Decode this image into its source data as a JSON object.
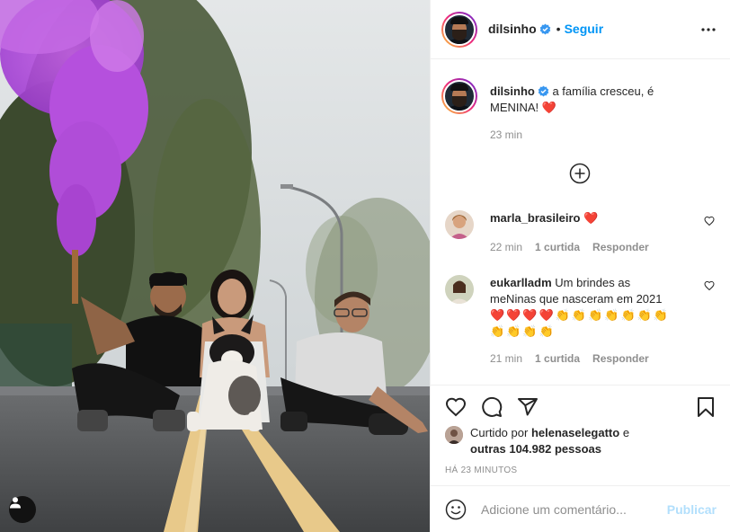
{
  "post": {
    "author": "dilsinho",
    "follow_label": "Seguir",
    "separator": "•",
    "caption_text": "a família cresceu, é MENINA!",
    "caption_emoji": "❤️",
    "caption_time": "23 min"
  },
  "comments": [
    {
      "username": "marla_brasileiro",
      "text": "",
      "emoji": "❤️",
      "time": "22 min",
      "likes": "1 curtida",
      "reply_label": "Responder"
    },
    {
      "username": "eukarlladm",
      "text": "Um brindes as meNinas que nasceram em 2021",
      "emoji_hearts": "❤️❤️❤️❤️",
      "emoji_claps": "👏👏👏👏👏👏👏👏👏👏👏",
      "time": "21 min",
      "likes": "1 curtida",
      "reply_label": "Responder"
    }
  ],
  "likes": {
    "prefix": "Curtido por",
    "user": "helenaselegatto",
    "connector": "e",
    "others": "outras 104.982 pessoas"
  },
  "timestamp": "HÁ 23 MINUTOS",
  "add_comment": {
    "placeholder": "Adicione um comentário...",
    "publish_label": "Publicar"
  },
  "colors": {
    "accent": "#0095f6",
    "heart": "#ed1c24",
    "publish_disabled": "#b2dffc",
    "smoke": "#b64fd9"
  },
  "icons": [
    "verified-icon",
    "more-icon",
    "plus-circle-icon",
    "heart-icon",
    "comment-icon",
    "share-icon",
    "bookmark-icon",
    "emoji-icon",
    "user-tag-icon"
  ]
}
